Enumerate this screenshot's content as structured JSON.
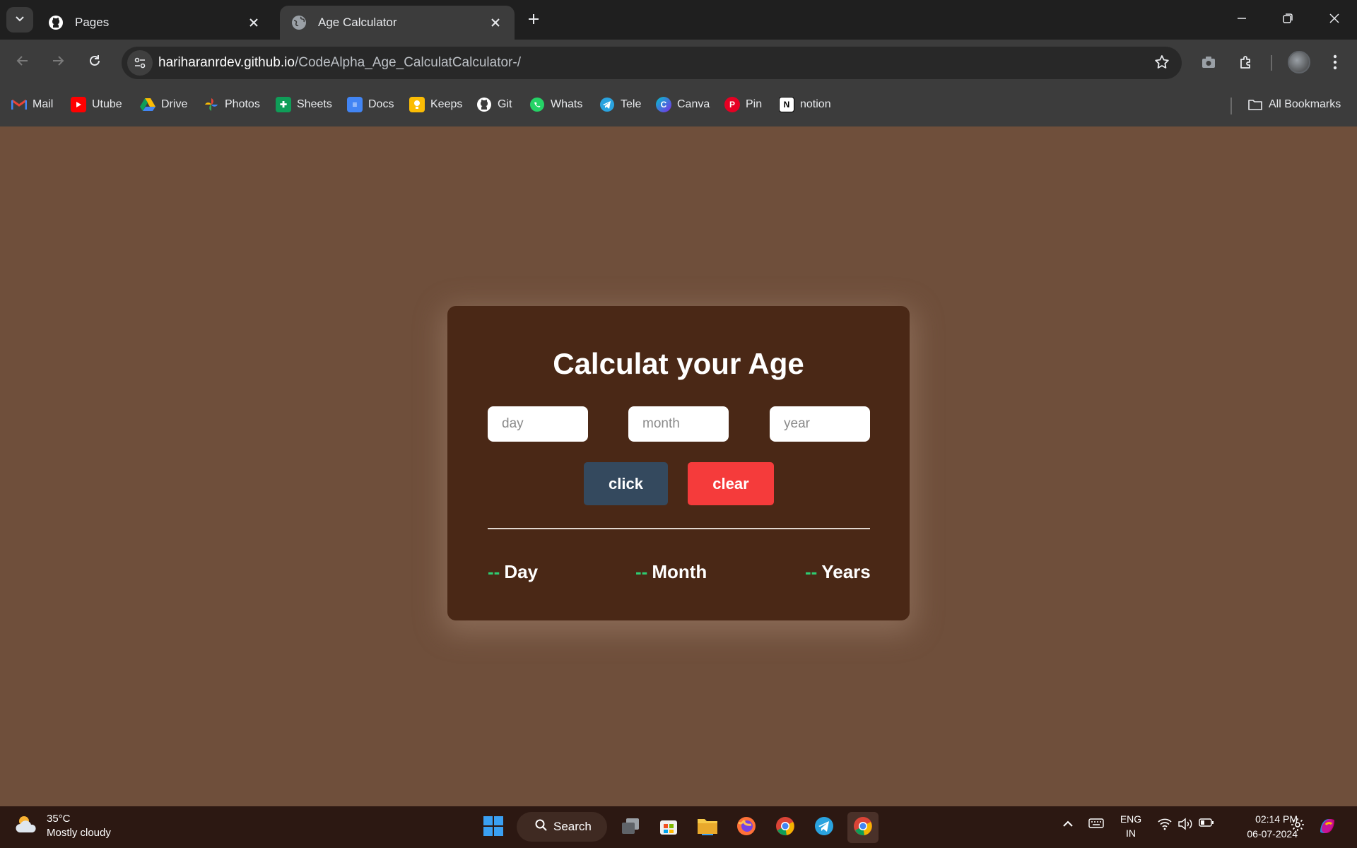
{
  "browser": {
    "tabs": [
      {
        "title": "Pages",
        "favicon": "github-icon"
      },
      {
        "title": "Age Calculator",
        "favicon": "globe-icon"
      }
    ],
    "url_host": "hariharanrdev.github.io",
    "url_path": "/CodeAlpha_Age_CalculatCalculator-/",
    "bookmarks": [
      "Mail",
      "Utube",
      "Drive",
      "Photos",
      "Sheets",
      "Docs",
      "Keeps",
      "Git",
      "Whats",
      "Tele",
      "Canva",
      "Pin",
      "notion"
    ],
    "all_bookmarks": "All Bookmarks"
  },
  "page": {
    "title": "Calculat your Age",
    "inputs": {
      "day_placeholder": "day",
      "month_placeholder": "month",
      "year_placeholder": "year"
    },
    "buttons": {
      "click_label": "click",
      "clear_label": "clear"
    },
    "results": [
      {
        "value": "--",
        "unit": "Day"
      },
      {
        "value": "--",
        "unit": "Month"
      },
      {
        "value": "--",
        "unit": "Years"
      }
    ],
    "colors": {
      "background": "#6f4f3b",
      "card": "#4a2816",
      "click_button": "#34495e",
      "clear_button": "#f53b3b",
      "result_dash": "#2ecc71"
    }
  },
  "taskbar": {
    "weather_temp": "35°C",
    "weather_desc": "Mostly cloudy",
    "search_label": "Search",
    "lang_line1": "ENG",
    "lang_line2": "IN",
    "time": "02:14 PM",
    "date": "06-07-2024"
  }
}
